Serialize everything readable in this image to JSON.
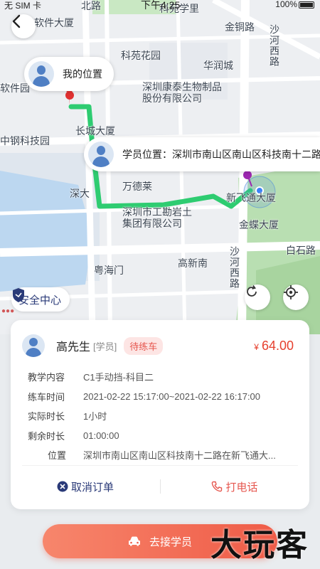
{
  "status_bar": {
    "carrier": "无 SIM 卡",
    "time": "下午4:25",
    "battery": "100%"
  },
  "map": {
    "labels": {
      "l1": "软件大厦",
      "l2": "北路",
      "l3": "科苑学里",
      "l4": "金铜路",
      "l5": "沙河西路",
      "l6": "科苑花园",
      "l7": "华润城",
      "l8": "深圳康泰生物制品",
      "l9": "股份有限公司",
      "l10": "软件园",
      "l11": "长城大厦",
      "l12": "中钢科技园",
      "l13": "万德莱",
      "l14": "深大",
      "l15": "新飞通大厦",
      "l16": "深圳市工勘岩土",
      "l17": "集团有限公司",
      "l18": "金蝶大厦",
      "l19": "白石路",
      "l20": "沙河西路",
      "l21": "高新南",
      "l22": "粤海门"
    },
    "my_location": "我的位置",
    "student_location": "学员位置：深圳市南山区南山区科技南十二路",
    "safety_center": "安全中心",
    "route_color": "#2ecc71"
  },
  "order": {
    "name": "高先生",
    "role": "[学员]",
    "status": "待练车",
    "currency": "¥",
    "price": "64.00",
    "rows": [
      {
        "key": "教学内容",
        "value": "C1手动挡-科目二"
      },
      {
        "key": "练车时间",
        "value": "2021-02-22 15:17:00~2021-02-22 16:17:00"
      },
      {
        "key": "实际时长",
        "value": "1小时"
      },
      {
        "key": "剩余时长",
        "value": "01:00:00"
      },
      {
        "key": "位置",
        "value": "深圳市南山区南山区科技南十二路在新飞通大..."
      }
    ],
    "cancel_label": "取消订单",
    "call_label": "打电话"
  },
  "primary_button": "去接学员",
  "watermark": "大玩客",
  "colors": {
    "accent": "#ef5b47",
    "navy": "#2a3a78",
    "route": "#2ecc71"
  }
}
